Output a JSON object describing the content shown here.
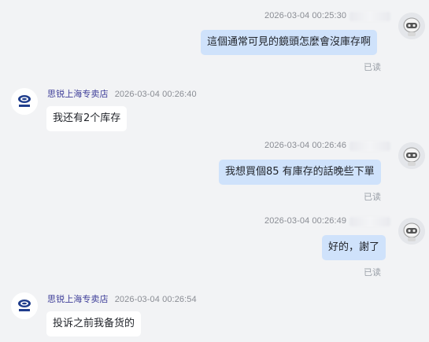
{
  "colors": {
    "background": "#f2f3f5",
    "outgoing_bubble": "#cfe2fb",
    "incoming_bubble": "#ffffff",
    "shop_name": "#3f3f99",
    "meta_text": "#8a8d94"
  },
  "messages": [
    {
      "direction": "out",
      "time": "2026-03-04 00:25:30",
      "text": "這個通常可見的鏡頭怎麼會沒庫存啊",
      "status": "已读",
      "avatar": "robot-avatar-icon"
    },
    {
      "direction": "in",
      "sender": "思锐上海专卖店",
      "time": "2026-03-04 00:26:40",
      "text": "我还有2个库存",
      "avatar": "sirui-logo-icon"
    },
    {
      "direction": "out",
      "time": "2026-03-04 00:26:46",
      "text": "我想買個85 有庫存的話晚些下單",
      "status": "已读",
      "avatar": "robot-avatar-icon"
    },
    {
      "direction": "out",
      "time": "2026-03-04 00:26:49",
      "text": "好的，謝了",
      "status": "已读",
      "avatar": "robot-avatar-icon"
    },
    {
      "direction": "in",
      "sender": "思锐上海专卖店",
      "time": "2026-03-04 00:26:54",
      "text": "投诉之前我备货的",
      "avatar": "sirui-logo-icon"
    }
  ]
}
